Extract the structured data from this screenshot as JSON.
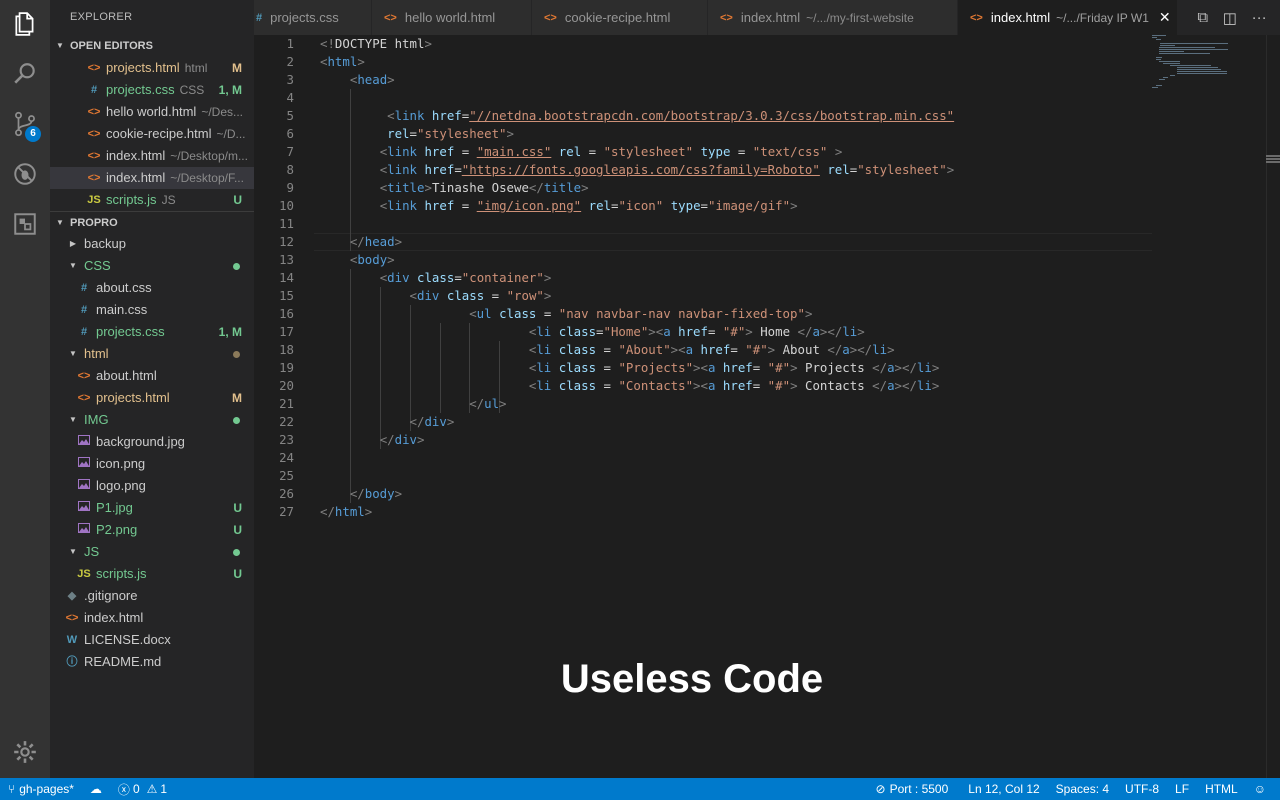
{
  "activity_bar": {
    "items": [
      {
        "icon": "files-icon"
      },
      {
        "icon": "search-icon"
      },
      {
        "icon": "source-control-icon",
        "badge": "6"
      },
      {
        "icon": "debug-icon"
      },
      {
        "icon": "extensions-icon"
      }
    ],
    "settings_icon": "gear-icon"
  },
  "sidebar": {
    "title": "EXPLORER",
    "open_editors": {
      "label": "OPEN EDITORS",
      "items": [
        {
          "name": "projects.html",
          "detail": "html",
          "badge": "M",
          "icon": "<>",
          "color": "#e2c08d",
          "icon_color": "#e37933"
        },
        {
          "name": "projects.css",
          "detail": "CSS",
          "badge": "1, M",
          "icon": "#",
          "color": "#73c991",
          "icon_color": "#519aba"
        },
        {
          "name": "hello world.html",
          "detail": "~/Des...",
          "badge": "",
          "icon": "<>",
          "color": "#cccccc",
          "icon_color": "#e37933"
        },
        {
          "name": "cookie-recipe.html",
          "detail": "~/D...",
          "badge": "",
          "icon": "<>",
          "color": "#cccccc",
          "icon_color": "#e37933"
        },
        {
          "name": "index.html",
          "detail": "~/Desktop/m...",
          "badge": "",
          "icon": "<>",
          "color": "#cccccc",
          "icon_color": "#e37933"
        },
        {
          "name": "index.html",
          "detail": "~/Desktop/F...",
          "badge": "",
          "icon": "<>",
          "color": "#cccccc",
          "icon_color": "#e37933",
          "selected": true
        },
        {
          "name": "scripts.js",
          "detail": "JS",
          "badge": "U",
          "icon": "JS",
          "color": "#73c991",
          "icon_color": "#cbcb41"
        }
      ]
    },
    "project": {
      "label": "PROPRO",
      "items": [
        {
          "type": "folder",
          "name": "backup",
          "open": false,
          "color": "#cccccc"
        },
        {
          "type": "folder",
          "name": "CSS",
          "open": true,
          "color": "#73c991",
          "dot": "#73c991"
        },
        {
          "type": "file",
          "name": "about.css",
          "icon": "#",
          "icon_color": "#519aba",
          "color": "#cccccc",
          "badge": ""
        },
        {
          "type": "file",
          "name": "main.css",
          "icon": "#",
          "icon_color": "#519aba",
          "color": "#cccccc",
          "badge": ""
        },
        {
          "type": "file",
          "name": "projects.css",
          "icon": "#",
          "icon_color": "#519aba",
          "color": "#73c991",
          "badge": "1, M"
        },
        {
          "type": "folder",
          "name": "html",
          "open": true,
          "color": "#e2c08d",
          "dot": "#8b7a5a"
        },
        {
          "type": "file",
          "name": "about.html",
          "icon": "<>",
          "icon_color": "#e37933",
          "color": "#cccccc",
          "badge": ""
        },
        {
          "type": "file",
          "name": "projects.html",
          "icon": "<>",
          "icon_color": "#e37933",
          "color": "#e2c08d",
          "badge": "M"
        },
        {
          "type": "folder",
          "name": "IMG",
          "open": true,
          "color": "#73c991",
          "dot": "#73c991"
        },
        {
          "type": "file",
          "name": "background.jpg",
          "icon": "img",
          "icon_color": "#a074c4",
          "color": "#cccccc",
          "badge": ""
        },
        {
          "type": "file",
          "name": "icon.png",
          "icon": "img",
          "icon_color": "#a074c4",
          "color": "#cccccc",
          "badge": ""
        },
        {
          "type": "file",
          "name": "logo.png",
          "icon": "img",
          "icon_color": "#a074c4",
          "color": "#cccccc",
          "badge": ""
        },
        {
          "type": "file",
          "name": "P1.jpg",
          "icon": "img",
          "icon_color": "#a074c4",
          "color": "#73c991",
          "badge": "U"
        },
        {
          "type": "file",
          "name": "P2.png",
          "icon": "img",
          "icon_color": "#a074c4",
          "color": "#73c991",
          "badge": "U"
        },
        {
          "type": "folder",
          "name": "JS",
          "open": true,
          "color": "#73c991",
          "dot": "#73c991"
        },
        {
          "type": "file",
          "name": "scripts.js",
          "icon": "JS",
          "icon_color": "#cbcb41",
          "color": "#73c991",
          "badge": "U"
        },
        {
          "type": "root-file",
          "name": ".gitignore",
          "icon": "◆",
          "icon_color": "#6d8086",
          "color": "#cccccc",
          "badge": ""
        },
        {
          "type": "root-file",
          "name": "index.html",
          "icon": "<>",
          "icon_color": "#e37933",
          "color": "#cccccc",
          "badge": ""
        },
        {
          "type": "root-file",
          "name": "LICENSE.docx",
          "icon": "W",
          "icon_color": "#519aba",
          "color": "#cccccc",
          "badge": ""
        },
        {
          "type": "root-file",
          "name": "README.md",
          "icon": "ⓘ",
          "icon_color": "#519aba",
          "color": "#cccccc",
          "badge": ""
        }
      ]
    }
  },
  "tabs": [
    {
      "icon": "#",
      "icon_color": "#519aba",
      "label": "projects.css",
      "detail": ""
    },
    {
      "icon": "<>",
      "icon_color": "#e37933",
      "label": "hello world.html",
      "detail": ""
    },
    {
      "icon": "<>",
      "icon_color": "#e37933",
      "label": "cookie-recipe.html",
      "detail": ""
    },
    {
      "icon": "<>",
      "icon_color": "#e37933",
      "label": "index.html",
      "detail": "~/.../my-first-website"
    },
    {
      "icon": "<>",
      "icon_color": "#e37933",
      "label": "index.html",
      "detail": "~/.../Friday IP W1",
      "active": true
    }
  ],
  "tab_actions": [
    "split-compare-icon",
    "split-editor-icon",
    "more-icon"
  ],
  "editor": {
    "current_line": 12,
    "lines": [
      [
        [
          "p",
          "<!"
        ],
        [
          "x",
          "DOCTYPE html"
        ],
        [
          "p",
          ">"
        ]
      ],
      [
        [
          "p",
          "<"
        ],
        [
          "t",
          "html"
        ],
        [
          "p",
          ">"
        ]
      ],
      [
        [
          "x",
          "    "
        ],
        [
          "p",
          "<"
        ],
        [
          "t",
          "head"
        ],
        [
          "p",
          ">"
        ]
      ],
      [],
      [
        [
          "x",
          "         "
        ],
        [
          "p",
          "<"
        ],
        [
          "t",
          "link"
        ],
        [
          "x",
          " "
        ],
        [
          "a",
          "href"
        ],
        [
          "x",
          "="
        ],
        [
          "s",
          "\"//netdna.bootstrapcdn.com/bootstrap/3.0.3/css/bootstrap.min.css\""
        ]
      ],
      [
        [
          "x",
          "         "
        ],
        [
          "a",
          "rel"
        ],
        [
          "x",
          "="
        ],
        [
          "s",
          "\"stylesheet\""
        ],
        [
          "p",
          ">"
        ]
      ],
      [
        [
          "x",
          "        "
        ],
        [
          "p",
          "<"
        ],
        [
          "t",
          "link"
        ],
        [
          "x",
          " "
        ],
        [
          "a",
          "href"
        ],
        [
          "x",
          " = "
        ],
        [
          "s",
          "\"main.css\""
        ],
        [
          "x",
          " "
        ],
        [
          "a",
          "rel"
        ],
        [
          "x",
          " = "
        ],
        [
          "s",
          "\"stylesheet\""
        ],
        [
          "x",
          " "
        ],
        [
          "a",
          "type"
        ],
        [
          "x",
          " = "
        ],
        [
          "s",
          "\"text/css\""
        ],
        [
          "x",
          " "
        ],
        [
          "p",
          ">"
        ]
      ],
      [
        [
          "x",
          "        "
        ],
        [
          "p",
          "<"
        ],
        [
          "t",
          "link"
        ],
        [
          "x",
          " "
        ],
        [
          "a",
          "href"
        ],
        [
          "x",
          "="
        ],
        [
          "s",
          "\"https://fonts.googleapis.com/css?family=Roboto\""
        ],
        [
          "x",
          " "
        ],
        [
          "a",
          "rel"
        ],
        [
          "x",
          "="
        ],
        [
          "s",
          "\"stylesheet\""
        ],
        [
          "p",
          ">"
        ]
      ],
      [
        [
          "x",
          "        "
        ],
        [
          "p",
          "<"
        ],
        [
          "t",
          "title"
        ],
        [
          "p",
          ">"
        ],
        [
          "x",
          "Tinashe Osewe"
        ],
        [
          "p",
          "</"
        ],
        [
          "t",
          "title"
        ],
        [
          "p",
          ">"
        ]
      ],
      [
        [
          "x",
          "        "
        ],
        [
          "p",
          "<"
        ],
        [
          "t",
          "link"
        ],
        [
          "x",
          " "
        ],
        [
          "a",
          "href"
        ],
        [
          "x",
          " = "
        ],
        [
          "s",
          "\"img/icon.png\""
        ],
        [
          "x",
          " "
        ],
        [
          "a",
          "rel"
        ],
        [
          "x",
          "="
        ],
        [
          "s",
          "\"icon\""
        ],
        [
          "x",
          " "
        ],
        [
          "a",
          "type"
        ],
        [
          "x",
          "="
        ],
        [
          "s",
          "\"image/gif\""
        ],
        [
          "p",
          ">"
        ]
      ],
      [],
      [
        [
          "x",
          "    "
        ],
        [
          "p",
          "</"
        ],
        [
          "t",
          "head"
        ],
        [
          "p",
          ">"
        ]
      ],
      [
        [
          "x",
          "    "
        ],
        [
          "p",
          "<"
        ],
        [
          "t",
          "body"
        ],
        [
          "p",
          ">"
        ]
      ],
      [
        [
          "x",
          "        "
        ],
        [
          "p",
          "<"
        ],
        [
          "t",
          "div"
        ],
        [
          "x",
          " "
        ],
        [
          "a",
          "class"
        ],
        [
          "x",
          "="
        ],
        [
          "s",
          "\"container\""
        ],
        [
          "p",
          ">"
        ]
      ],
      [
        [
          "x",
          "            "
        ],
        [
          "p",
          "<"
        ],
        [
          "t",
          "div"
        ],
        [
          "x",
          " "
        ],
        [
          "a",
          "class"
        ],
        [
          "x",
          " = "
        ],
        [
          "s",
          "\"row\""
        ],
        [
          "p",
          ">"
        ]
      ],
      [
        [
          "x",
          "                    "
        ],
        [
          "p",
          "<"
        ],
        [
          "t",
          "ul"
        ],
        [
          "x",
          " "
        ],
        [
          "a",
          "class"
        ],
        [
          "x",
          " = "
        ],
        [
          "s",
          "\"nav navbar-nav navbar-fixed-top\""
        ],
        [
          "p",
          ">"
        ]
      ],
      [
        [
          "x",
          "                            "
        ],
        [
          "p",
          "<"
        ],
        [
          "t",
          "li"
        ],
        [
          "x",
          " "
        ],
        [
          "a",
          "class"
        ],
        [
          "x",
          "="
        ],
        [
          "s",
          "\"Home\""
        ],
        [
          "p",
          "><"
        ],
        [
          "t",
          "a"
        ],
        [
          "x",
          " "
        ],
        [
          "a",
          "href"
        ],
        [
          "x",
          "= "
        ],
        [
          "s",
          "\"#\""
        ],
        [
          "p",
          ">"
        ],
        [
          "x",
          " Home "
        ],
        [
          "p",
          "</"
        ],
        [
          "t",
          "a"
        ],
        [
          "p",
          "></"
        ],
        [
          "t",
          "li"
        ],
        [
          "p",
          ">"
        ]
      ],
      [
        [
          "x",
          "                            "
        ],
        [
          "p",
          "<"
        ],
        [
          "t",
          "li"
        ],
        [
          "x",
          " "
        ],
        [
          "a",
          "class"
        ],
        [
          "x",
          " = "
        ],
        [
          "s",
          "\"About\""
        ],
        [
          "p",
          "><"
        ],
        [
          "t",
          "a"
        ],
        [
          "x",
          " "
        ],
        [
          "a",
          "href"
        ],
        [
          "x",
          "= "
        ],
        [
          "s",
          "\"#\""
        ],
        [
          "p",
          ">"
        ],
        [
          "x",
          " About "
        ],
        [
          "p",
          "</"
        ],
        [
          "t",
          "a"
        ],
        [
          "p",
          "></"
        ],
        [
          "t",
          "li"
        ],
        [
          "p",
          ">"
        ]
      ],
      [
        [
          "x",
          "                            "
        ],
        [
          "p",
          "<"
        ],
        [
          "t",
          "li"
        ],
        [
          "x",
          " "
        ],
        [
          "a",
          "class"
        ],
        [
          "x",
          " = "
        ],
        [
          "s",
          "\"Projects\""
        ],
        [
          "p",
          "><"
        ],
        [
          "t",
          "a"
        ],
        [
          "x",
          " "
        ],
        [
          "a",
          "href"
        ],
        [
          "x",
          "= "
        ],
        [
          "s",
          "\"#\""
        ],
        [
          "p",
          ">"
        ],
        [
          "x",
          " Projects "
        ],
        [
          "p",
          "</"
        ],
        [
          "t",
          "a"
        ],
        [
          "p",
          "></"
        ],
        [
          "t",
          "li"
        ],
        [
          "p",
          ">"
        ]
      ],
      [
        [
          "x",
          "                            "
        ],
        [
          "p",
          "<"
        ],
        [
          "t",
          "li"
        ],
        [
          "x",
          " "
        ],
        [
          "a",
          "class"
        ],
        [
          "x",
          " = "
        ],
        [
          "s",
          "\"Contacts\""
        ],
        [
          "p",
          "><"
        ],
        [
          "t",
          "a"
        ],
        [
          "x",
          " "
        ],
        [
          "a",
          "href"
        ],
        [
          "x",
          "= "
        ],
        [
          "s",
          "\"#\""
        ],
        [
          "p",
          ">"
        ],
        [
          "x",
          " Contacts "
        ],
        [
          "p",
          "</"
        ],
        [
          "t",
          "a"
        ],
        [
          "p",
          "></"
        ],
        [
          "t",
          "li"
        ],
        [
          "p",
          ">"
        ]
      ],
      [
        [
          "x",
          "                    "
        ],
        [
          "p",
          "</"
        ],
        [
          "t",
          "ul"
        ],
        [
          "p",
          ">"
        ]
      ],
      [
        [
          "x",
          "            "
        ],
        [
          "p",
          "</"
        ],
        [
          "t",
          "div"
        ],
        [
          "p",
          ">"
        ]
      ],
      [
        [
          "x",
          "        "
        ],
        [
          "p",
          "</"
        ],
        [
          "t",
          "div"
        ],
        [
          "p",
          ">"
        ]
      ],
      [],
      [],
      [
        [
          "x",
          "    "
        ],
        [
          "p",
          "</"
        ],
        [
          "t",
          "body"
        ],
        [
          "p",
          ">"
        ]
      ],
      [
        [
          "p",
          "</"
        ],
        [
          "t",
          "html"
        ],
        [
          "p",
          ">"
        ]
      ]
    ]
  },
  "overlay_caption": "Useless Code",
  "statusbar": {
    "branch": "gh-pages*",
    "sync_icon": "cloud-upload-icon",
    "errors": "0",
    "warnings": "1",
    "port": "Port : 5500",
    "position": "Ln 12, Col 12",
    "spaces": "Spaces: 4",
    "encoding": "UTF-8",
    "eol": "LF",
    "language": "HTML"
  },
  "colors": {
    "accent": "#007acc",
    "modified": "#e2c08d",
    "untracked": "#73c991"
  }
}
